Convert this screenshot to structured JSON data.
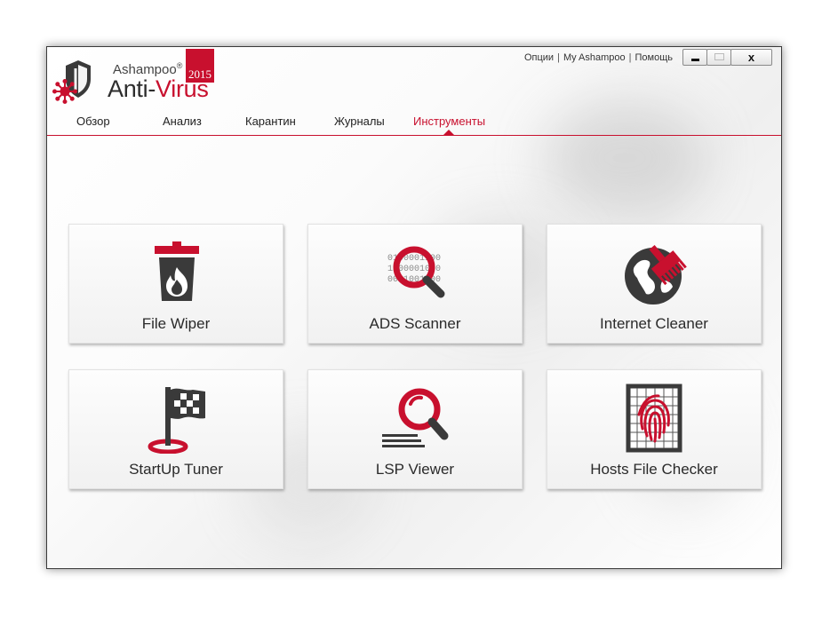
{
  "app": {
    "brand_small": "Ashampoo",
    "brand_reg": "®",
    "brand_word1": "Anti-",
    "brand_word2": "Virus",
    "badge_year": "2015"
  },
  "top_links": {
    "options": "Опции",
    "my_ashampoo": "My Ashampoo",
    "help": "Помощь",
    "separator": "|"
  },
  "window_controls": {
    "close_label": "x"
  },
  "tabs": [
    {
      "label": "Обзор",
      "active": false
    },
    {
      "label": "Анализ",
      "active": false
    },
    {
      "label": "Карантин",
      "active": false
    },
    {
      "label": "Журналы",
      "active": false
    },
    {
      "label": "Инструменты",
      "active": true
    }
  ],
  "tools": [
    {
      "label": "File Wiper",
      "icon": "trash-fire-icon"
    },
    {
      "label": "ADS Scanner",
      "icon": "binary-magnifier-icon"
    },
    {
      "label": "Internet Cleaner",
      "icon": "globe-brush-icon"
    },
    {
      "label": "StartUp Tuner",
      "icon": "flag-target-icon"
    },
    {
      "label": "LSP Viewer",
      "icon": "magnifier-lines-icon"
    },
    {
      "label": "Hosts File Checker",
      "icon": "fingerprint-grid-icon"
    }
  ],
  "ads_binary": [
    "0100001100",
    "1100001000",
    "0011001100"
  ],
  "colors": {
    "accent": "#c8102e",
    "icon_dark": "#3a3a3a"
  }
}
